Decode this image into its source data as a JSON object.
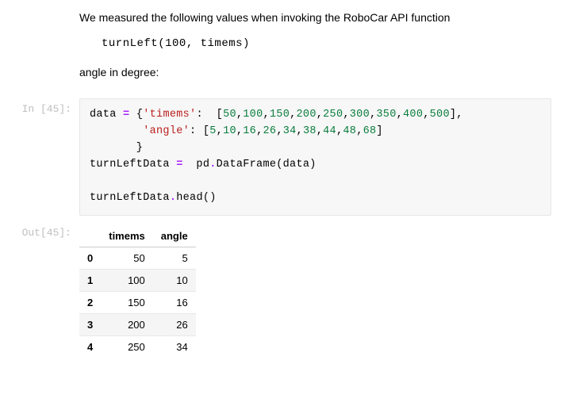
{
  "markdown": {
    "intro": "We measured the following values when invoking the RoboCar API function",
    "code_line": "turnLeft(100, timems)",
    "angle_label": "angle in degree:"
  },
  "prompts": {
    "in_label": "In [45]:",
    "out_label": "Out[45]:"
  },
  "code": {
    "l1_a": "data ",
    "l1_b": "=",
    "l1_c": " {",
    "l1_d": "'timems'",
    "l1_e": ":  [",
    "l1_f": "50",
    "l1_g": ",",
    "l1_h": "100",
    "l1_i": ",",
    "l1_j": "150",
    "l1_k": ",",
    "l1_l": "200",
    "l1_m": ",",
    "l1_n": "250",
    "l1_o": ",",
    "l1_p": "300",
    "l1_q": ",",
    "l1_r": "350",
    "l1_s": ",",
    "l1_t": "400",
    "l1_u": ",",
    "l1_v": "500",
    "l1_w": "],",
    "l2_a": "        ",
    "l2_b": "'angle'",
    "l2_c": ": [",
    "l2_d": "5",
    "l2_e": ",",
    "l2_f": "10",
    "l2_g": ",",
    "l2_h": "16",
    "l2_i": ",",
    "l2_j": "26",
    "l2_k": ",",
    "l2_l": "34",
    "l2_m": ",",
    "l2_n": "38",
    "l2_o": ",",
    "l2_p": "44",
    "l2_q": ",",
    "l2_r": "48",
    "l2_s": ",",
    "l2_t": "68",
    "l2_u": "]",
    "l3_a": "       }",
    "l4_a": "turnLeftData ",
    "l4_b": "=",
    "l4_c": "  pd",
    "l4_d": ".",
    "l4_e": "DataFrame(data)",
    "l5_blank": "",
    "l6_a": "turnLeftData",
    "l6_b": ".",
    "l6_c": "head()"
  },
  "table": {
    "columns": [
      "timems",
      "angle"
    ],
    "index": [
      "0",
      "1",
      "2",
      "3",
      "4"
    ],
    "rows": [
      [
        "50",
        "5"
      ],
      [
        "100",
        "10"
      ],
      [
        "150",
        "16"
      ],
      [
        "200",
        "26"
      ],
      [
        "250",
        "34"
      ]
    ]
  },
  "chart_data": {
    "type": "table",
    "columns": [
      "timems",
      "angle"
    ],
    "values": [
      [
        50,
        5
      ],
      [
        100,
        10
      ],
      [
        150,
        16
      ],
      [
        200,
        26
      ],
      [
        250,
        34
      ]
    ]
  }
}
